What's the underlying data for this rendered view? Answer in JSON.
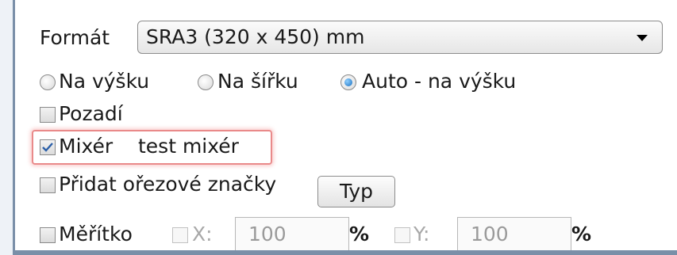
{
  "format": {
    "label": "Formát",
    "value": "SRA3 (320 x 450) mm"
  },
  "orientation": {
    "options": [
      {
        "label": "Na výšku",
        "checked": false
      },
      {
        "label": "Na šířku",
        "checked": false
      },
      {
        "label": "Auto - na výšku",
        "checked": true
      }
    ]
  },
  "options": {
    "pozadi": {
      "label": "Pozadí",
      "checked": false
    },
    "mixer": {
      "label": "Mixér",
      "checked": true,
      "value": "test mixér"
    },
    "orez": {
      "label": "Přidat ořezové značky",
      "checked": false
    },
    "typ_button": "Typ"
  },
  "scale": {
    "label": "Měřítko",
    "checked": false,
    "x": {
      "label": "X:",
      "value": "100",
      "unit": "%"
    },
    "y": {
      "label": "Y:",
      "value": "100",
      "unit": "%"
    }
  },
  "colors": {
    "highlight": "#e98a8a",
    "radio_selected": "#1a6fc0"
  }
}
